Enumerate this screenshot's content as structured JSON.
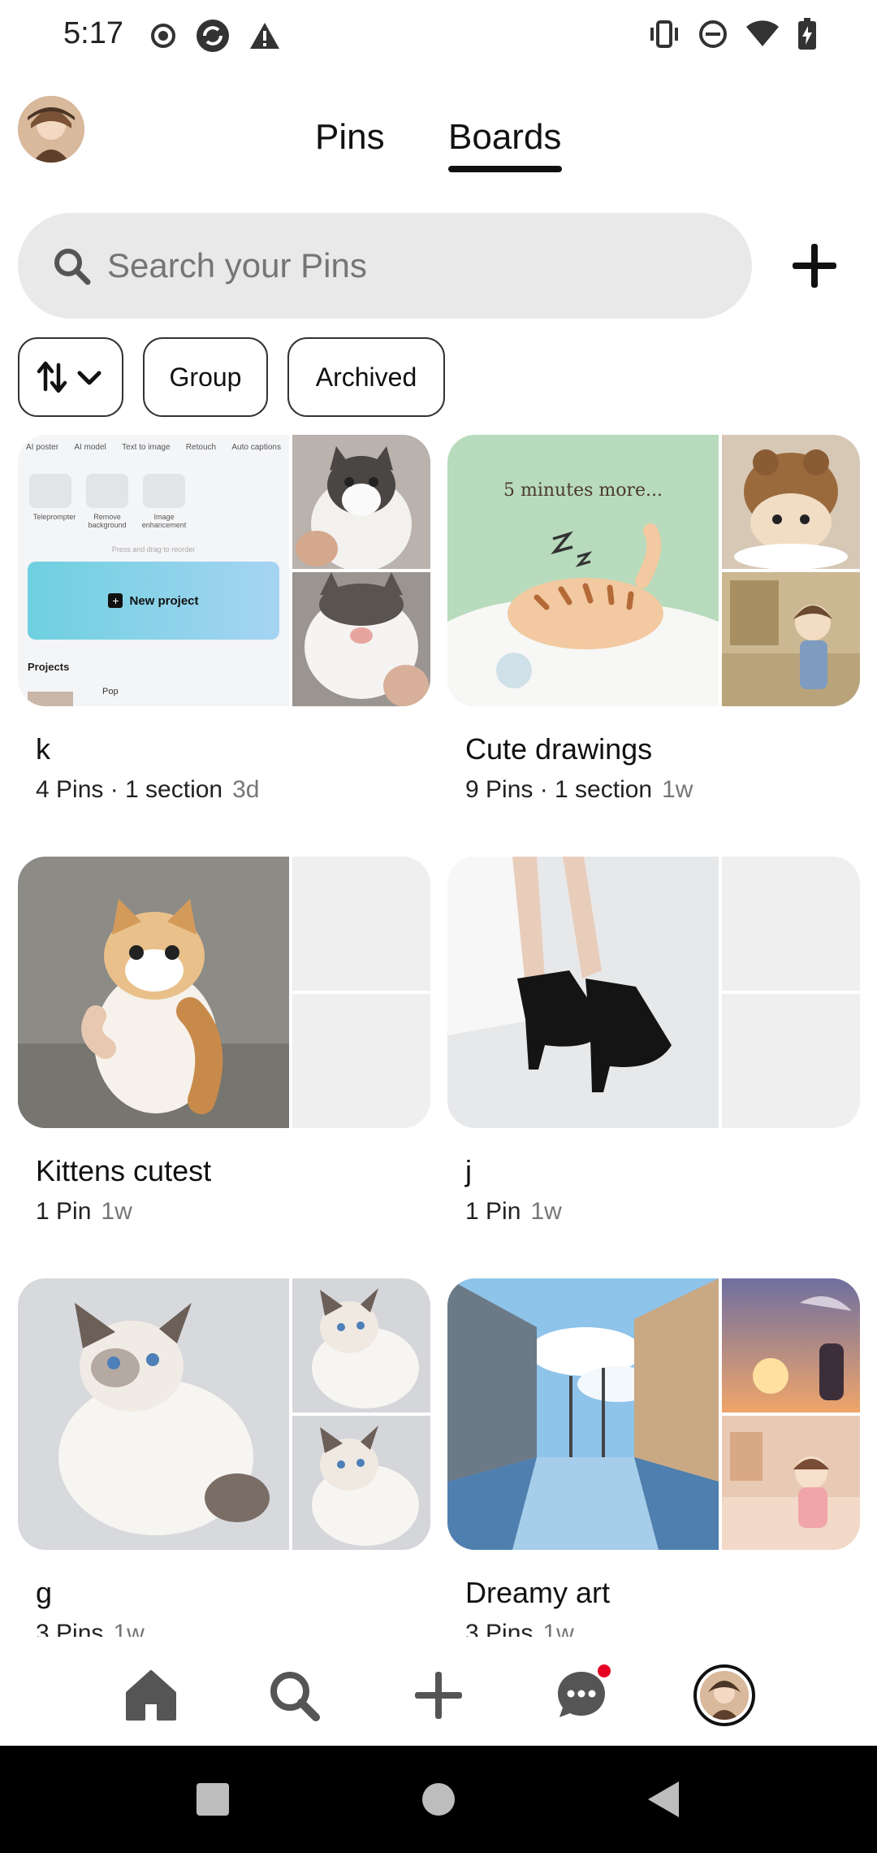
{
  "status_bar": {
    "time": "5:17",
    "left_icons": [
      "record-icon",
      "sync-icon",
      "warning-icon"
    ],
    "right_icons": [
      "vibrate-icon",
      "do-not-disturb-icon",
      "wifi-icon",
      "battery-charging-icon"
    ]
  },
  "header": {
    "tabs": [
      {
        "label": "Pins",
        "active": false
      },
      {
        "label": "Boards",
        "active": true
      }
    ]
  },
  "search": {
    "placeholder": "Search your Pins"
  },
  "filters": {
    "sort_icon": "sort-arrows-icon",
    "group_label": "Group",
    "archived_label": "Archived"
  },
  "boards": [
    {
      "title": "k",
      "pins": "4 Pins · 1 section",
      "age": "3d"
    },
    {
      "title": "Cute drawings",
      "pins": "9 Pins · 1 section",
      "age": "1w"
    },
    {
      "title": "Kittens cutest",
      "pins": "1 Pin",
      "age": "1w"
    },
    {
      "title": "j",
      "pins": "1 Pin",
      "age": "1w"
    },
    {
      "title": "g",
      "pins": "3 Pins",
      "age": "1w"
    },
    {
      "title": "Dreamy art",
      "pins": "3 Pins",
      "age": "1w"
    }
  ],
  "board_k_cover": {
    "menu_items": [
      "AI poster",
      "AI model",
      "Text to image",
      "Retouch",
      "Auto captions"
    ],
    "tools": [
      "Teleprompter",
      "Remove background",
      "Image enhancement"
    ],
    "hint": "Press and drag to reorder",
    "new_project": "New project",
    "projects_label": "Projects",
    "project_item": "Pop"
  },
  "cute_drawings_cover": {
    "caption": "5 minutes more..."
  },
  "bottom_nav": {
    "items": [
      "home-icon",
      "search-icon",
      "create-icon",
      "messages-icon",
      "profile-avatar"
    ],
    "messages_badge": true
  },
  "colors": {
    "accent": "#111111",
    "badge": "#e60023",
    "search_bg": "#e9e9e9",
    "muted_text": "#767676"
  }
}
